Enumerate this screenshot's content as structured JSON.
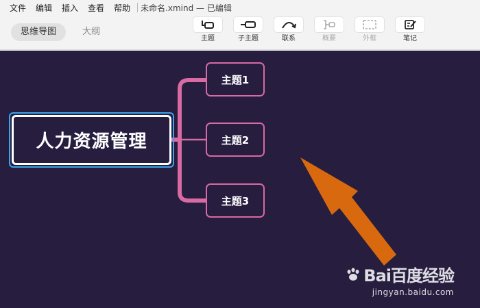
{
  "menu": {
    "items": [
      "文件",
      "编辑",
      "插入",
      "查看",
      "帮助"
    ],
    "doc_title": "未命名.xmind — 已编辑"
  },
  "view_tabs": {
    "mindmap": "思维导图",
    "outline": "大纲"
  },
  "toolbar": {
    "topic": "主题",
    "subtopic": "子主题",
    "relationship": "联系",
    "summary": "概要",
    "boundary": "外框",
    "note": "笔记"
  },
  "map": {
    "central": "人力资源管理",
    "subtopics": [
      "主题1",
      "主题2",
      "主题3"
    ]
  },
  "colors": {
    "canvas_bg": "#261d3f",
    "branch": "#d86aa4",
    "selection": "#3aa6ee",
    "arrow": "#d9690e"
  },
  "watermark": {
    "main": "Bai百度经验",
    "url": "jingyan.baidu.com"
  }
}
